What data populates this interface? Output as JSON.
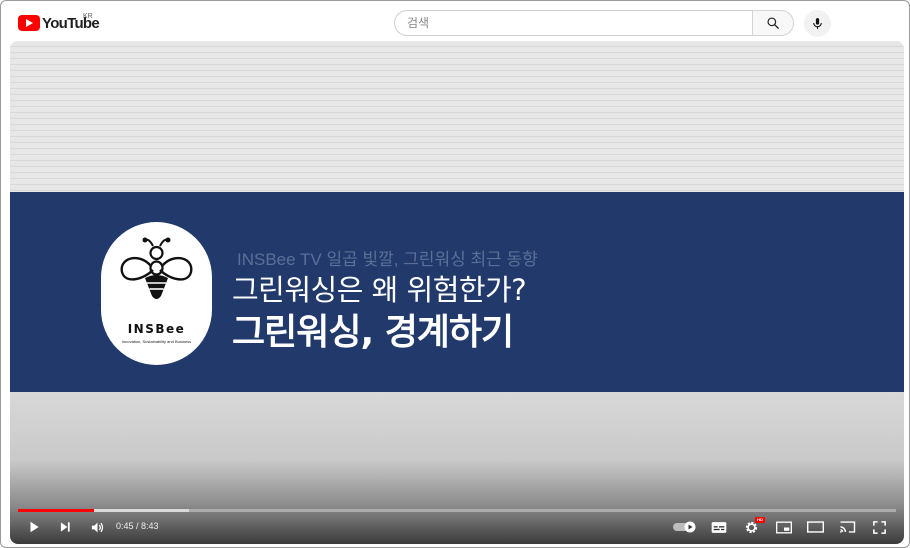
{
  "header": {
    "logo_text": "YouTube",
    "region": "KR",
    "search": {
      "placeholder": "검색",
      "value": ""
    }
  },
  "video": {
    "badge_name": "INSBee",
    "badge_tagline": "Innovation, Sustainability and Business",
    "subtitle": "INSBee TV 일곱 빛깔, 그린워싱 최근 동향",
    "title_line1": "그린워싱은 왜 위험한가?",
    "title_line2": "그린워싱, 경계하기"
  },
  "player": {
    "current_time": "0:45",
    "duration": "8:43",
    "time_display": "0:45 / 8:43",
    "played_fraction": 0.086,
    "buffered_fraction": 0.195,
    "quality_badge": "HD"
  },
  "colors": {
    "brand_red": "#ff0000",
    "band_navy": "#213a6b"
  }
}
